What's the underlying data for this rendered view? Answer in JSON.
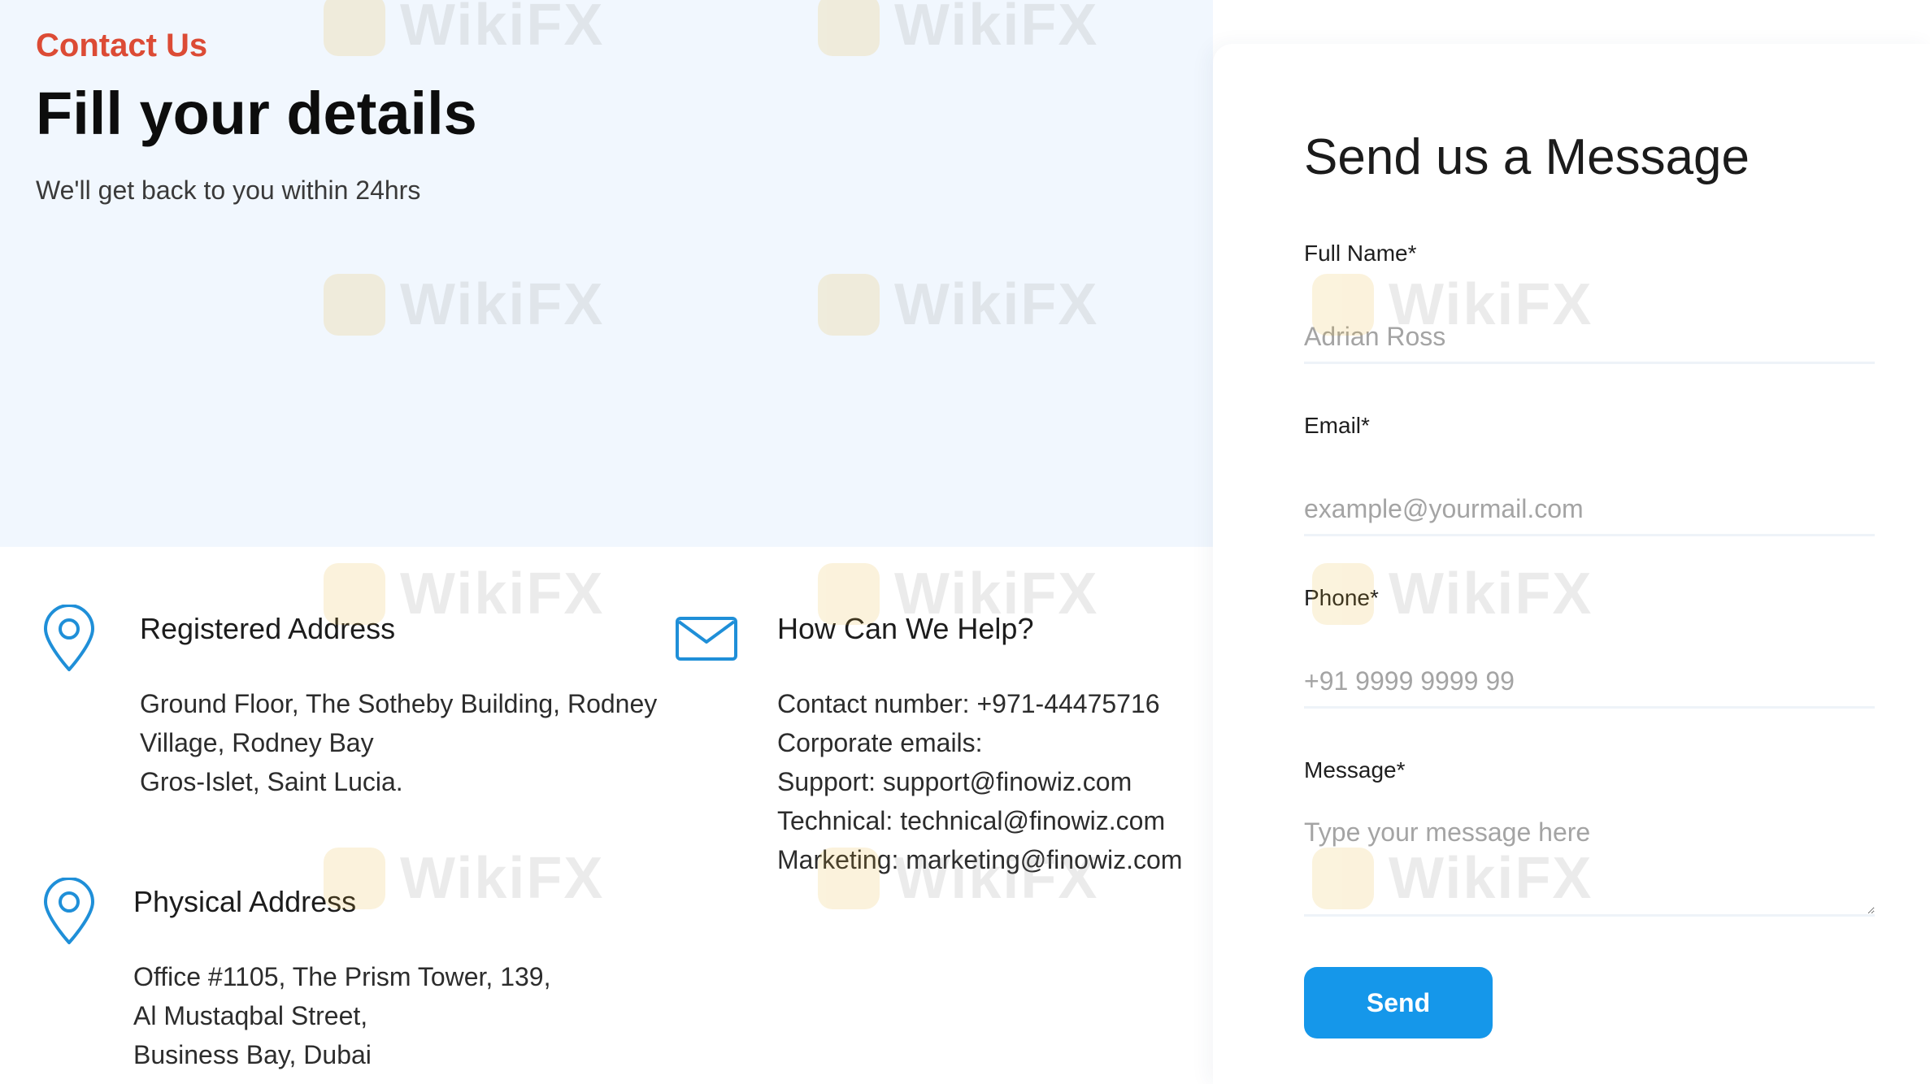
{
  "hero": {
    "eyebrow": "Contact Us",
    "title": "Fill your details",
    "subtitle": "We'll get back to you within 24hrs"
  },
  "registered_address": {
    "title": "Registered Address",
    "lines": [
      "Ground Floor, The Sotheby Building, Rodney",
      "Village, Rodney Bay",
      "Gros-Islet, Saint Lucia."
    ]
  },
  "help": {
    "title": "How Can We Help?",
    "lines": [
      "Contact number: +971-44475716",
      "Corporate emails:",
      "Support: support@finowiz.com",
      "Technical: technical@finowiz.com",
      "Marketing: marketing@finowiz.com"
    ]
  },
  "physical_address": {
    "title": "Physical Address",
    "lines": [
      "Office #1105, The Prism Tower, 139,",
      "Al Mustaqbal Street,",
      "Business Bay, Dubai"
    ]
  },
  "form": {
    "title": "Send us a Message",
    "full_name": {
      "label": "Full Name*",
      "placeholder": "Adrian Ross"
    },
    "email": {
      "label": "Email*",
      "placeholder": "example@yourmail.com"
    },
    "phone": {
      "label": "Phone*",
      "placeholder": "+91 9999 9999 99"
    },
    "message": {
      "label": "Message*",
      "placeholder": "Type your message here"
    },
    "send_label": "Send"
  },
  "watermark": {
    "text": "WikiFX"
  },
  "colors": {
    "accent_red": "#dc4b35",
    "button_blue": "#1597ea",
    "icon_blue": "#1f8fd8",
    "hero_background": "#f1f7fe"
  },
  "icons": {
    "location": "map-pin-icon",
    "email": "envelope-icon"
  }
}
